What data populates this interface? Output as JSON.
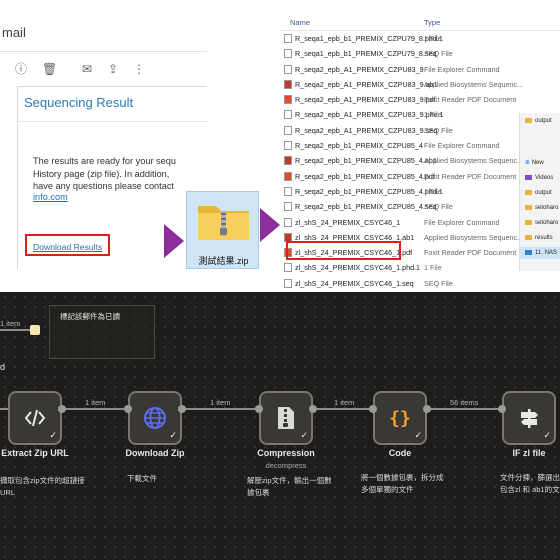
{
  "mail": {
    "header": "mail",
    "card_title": "Sequencing Result",
    "body_lines": "The results are ready for your sequ\nHistory page (zip file). In addition,\nhave any questions please contact",
    "link_text": "info.com",
    "download_link": "Download Results"
  },
  "zip": {
    "filename": "測試結果.zip"
  },
  "explorer": {
    "col_name": "Name",
    "col_type": "Type",
    "files": [
      {
        "name": "R_seqa1_epb_b1_PREMIX_CZPU79_8.phd.1",
        "type": "1 File",
        "icon": "file"
      },
      {
        "name": "R_seqa1_epb_b1_PREMIX_CZPU79_8.seq",
        "type": "SEQ File",
        "icon": "file"
      },
      {
        "name": "R_seqa2_epb_A1_PREMIX_CZPU83_9",
        "type": "File Explorer Command",
        "icon": "file"
      },
      {
        "name": "R_seqa2_epb_A1_PREMIX_CZPU83_9.ab1",
        "type": "Applied Biosystems Sequenc...",
        "icon": "ab1"
      },
      {
        "name": "R_seqa2_epb_A1_PREMIX_CZPU83_9.pdf",
        "type": "Foxit Reader PDF Document",
        "icon": "pdf"
      },
      {
        "name": "R_seqa2_epb_A1_PREMIX_CZPU83_9.phd.1",
        "type": "1 File",
        "icon": "file"
      },
      {
        "name": "R_seqa2_epb_A1_PREMIX_CZPU83_9.seq",
        "type": "SEQ File",
        "icon": "file"
      },
      {
        "name": "R_seqa2_epb_b1_PREMIX_CZPU85_4",
        "type": "File Explorer Command",
        "icon": "file"
      },
      {
        "name": "R_seqa2_epb_b1_PREMIX_CZPU85_4.ab1",
        "type": "Applied Biosystems Sequenc...",
        "icon": "ab1"
      },
      {
        "name": "R_seqa2_epb_b1_PREMIX_CZPU85_4.pdf",
        "type": "Foxit Reader PDF Document",
        "icon": "pdf"
      },
      {
        "name": "R_seqa2_epb_b1_PREMIX_CZPU85_4.phd.1",
        "type": "1 File",
        "icon": "file"
      },
      {
        "name": "R_seqa2_epb_b1_PREMIX_CZPU85_4.seq",
        "type": "SEQ File",
        "icon": "file"
      },
      {
        "name": "zl_shS_24_PREMIX_CSYC46_1",
        "type": "File Explorer Command",
        "icon": "file"
      },
      {
        "name": "zl_shS_24_PREMIX_CSYC46_1.ab1",
        "type": "Applied Biosystems Sequenc...",
        "icon": "ab1"
      },
      {
        "name": "zl_shS_24_PREMIX_CSYC46_1.pdf",
        "type": "Foxit Reader PDF Document",
        "icon": "pdf"
      },
      {
        "name": "zl_shS_24_PREMIX_CSYC46_1.phd.1",
        "type": "1 File",
        "icon": "file"
      },
      {
        "name": "zl_shS_24_PREMIX_CSYC46_1.seq",
        "type": "SEQ File",
        "icon": "file"
      }
    ]
  },
  "sliver": {
    "top_folder": "output",
    "new_label": "New",
    "items": [
      "Videos",
      "output",
      "setoharo",
      "setoharo",
      "results",
      "11. NAS"
    ]
  },
  "workflow": {
    "sticky_text": "標記該郵件為已讀",
    "top_wire_label": "1 item",
    "nodes": [
      {
        "label": "Extract Zip URL",
        "sub": "",
        "desc": "擷取包含zip文件的超鏈接\nURL"
      },
      {
        "label": "Download Zip",
        "sub": "",
        "desc": "下載文件"
      },
      {
        "label": "Compression",
        "sub": "decompress",
        "desc": "解壓zip文件，輸出一個數\n據包裹"
      },
      {
        "label": "Code",
        "sub": "",
        "desc": "將一個數據包裹，拆分成\n多個單獨的文件"
      },
      {
        "label": "IF zl file",
        "sub": "",
        "desc": "文件分揀，篩選出\n包含zl 和 ab1的文"
      }
    ],
    "wire_labels": [
      "1 item",
      "1 item",
      "1 item",
      "56 items"
    ],
    "colors": {
      "code_orange": "#f0a030",
      "globe_blue": "#5b6cf0",
      "node_border": "#7a7772"
    }
  }
}
